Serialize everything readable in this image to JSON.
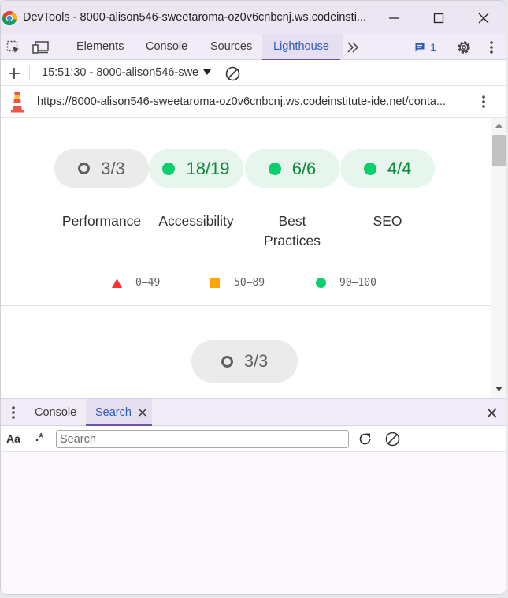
{
  "window": {
    "title": "DevTools - 8000-alison546-sweetaroma-oz0v6cnbcnj.ws.codeinsti..."
  },
  "tabs": {
    "elements": "Elements",
    "console": "Console",
    "sources": "Sources",
    "lighthouse": "Lighthouse",
    "issues_count": "1"
  },
  "report_bar": {
    "selected_report": "15:51:30 - 8000-alison546-swe"
  },
  "url_bar": {
    "url": "https://8000-alison546-sweetaroma-oz0v6cnbcnj.ws.codeinstitute-ide.net/conta..."
  },
  "scores": [
    {
      "value": "3/3",
      "label": "Performance",
      "status": "gray"
    },
    {
      "value": "18/19",
      "label": "Accessibility",
      "status": "green"
    },
    {
      "value": "6/6",
      "label": "Best Practices",
      "status": "green"
    },
    {
      "value": "4/4",
      "label": "SEO",
      "status": "green"
    }
  ],
  "score_labels": {
    "performance": "Performance",
    "accessibility": "Accessibility",
    "best_practices_line1": "Best",
    "best_practices_line2": "Practices",
    "seo": "SEO"
  },
  "legend": {
    "fail": "0–49",
    "average": "50–89",
    "pass": "90–100"
  },
  "section_gauge": {
    "value": "3/3"
  },
  "drawer": {
    "console_tab": "Console",
    "search_tab": "Search",
    "match_case": "Aa",
    "regex": ".*",
    "search_placeholder": "Search"
  },
  "colors": {
    "pass": "#0cce6b",
    "average": "#ffa400",
    "fail": "#ff3333",
    "accent": "#6a55a8"
  }
}
